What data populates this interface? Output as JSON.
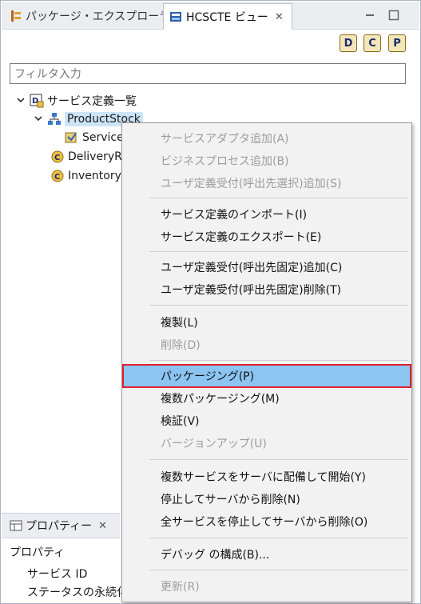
{
  "tabs": {
    "package_explorer": "パッケージ・エクスプローラー",
    "hcscte_view": "HCSCTE ビュー",
    "close_glyph": "✕"
  },
  "view_toolbar": [
    "D",
    "C",
    "P"
  ],
  "filter": {
    "placeholder": "フィルタ入力",
    "value": ""
  },
  "tree": {
    "root": "サービス定義一覧",
    "product_stock": "ProductStock",
    "service": "Service",
    "delivery": "DeliveryR",
    "inventory": "Inventory"
  },
  "properties": {
    "tab_label": "プロパティー",
    "heading": "プロパティ",
    "rows": [
      "サービス ID",
      "ステータスの永続化"
    ]
  },
  "context_menu": {
    "items": [
      {
        "label": "サービスアダプタ追加(A)",
        "enabled": false
      },
      {
        "label": "ビジネスプロセス追加(B)",
        "enabled": false
      },
      {
        "label": "ユーザ定義受付(呼出先選択)追加(S)",
        "enabled": false
      },
      {
        "label": "サービス定義のインポート(I)",
        "enabled": true
      },
      {
        "label": "サービス定義のエクスポート(E)",
        "enabled": true
      },
      {
        "label": "ユーザ定義受付(呼出先固定)追加(C)",
        "enabled": true
      },
      {
        "label": "ユーザ定義受付(呼出先固定)削除(T)",
        "enabled": true
      },
      {
        "label": "複製(L)",
        "enabled": true
      },
      {
        "label": "削除(D)",
        "enabled": false
      },
      {
        "label": "パッケージング(P)",
        "enabled": true,
        "highlighted": true
      },
      {
        "label": "複数パッケージング(M)",
        "enabled": true
      },
      {
        "label": "検証(V)",
        "enabled": true
      },
      {
        "label": "バージョンアップ(U)",
        "enabled": false
      },
      {
        "label": "複数サービスをサーバに配備して開始(Y)",
        "enabled": true
      },
      {
        "label": "停止してサーバから削除(N)",
        "enabled": true
      },
      {
        "label": "全サービスを停止してサーバから削除(O)",
        "enabled": true
      },
      {
        "label": "デバッグ の構成(B)...",
        "enabled": true
      },
      {
        "label": "更新(R)",
        "enabled": false
      }
    ]
  },
  "colors": {
    "highlight": "#8cc4f2",
    "annotation_box": "#e0202a"
  }
}
